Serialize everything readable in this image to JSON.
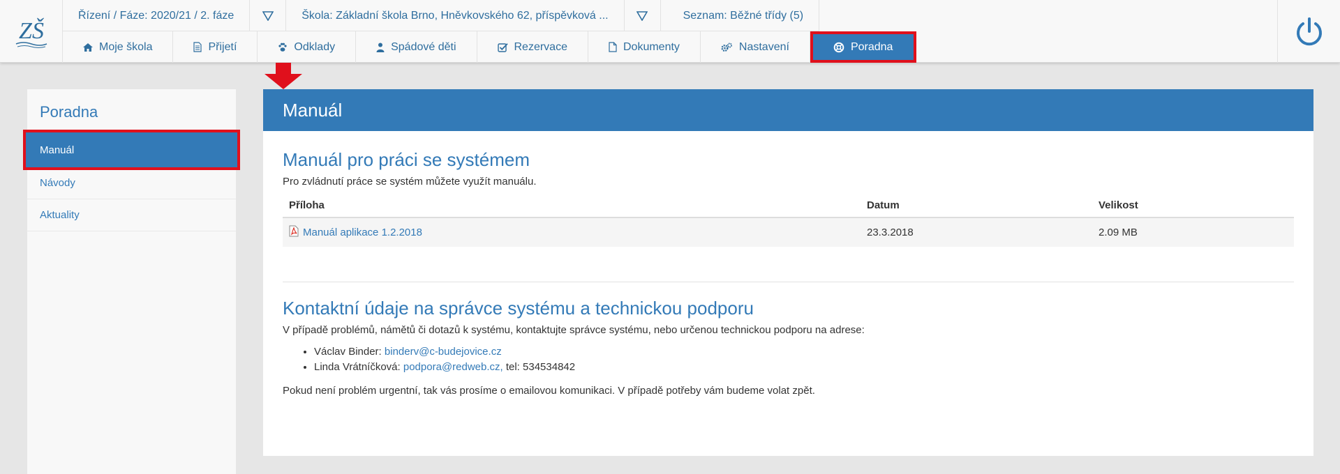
{
  "header": {
    "logo_text": "ZŠ",
    "context": {
      "phase": "Řízení / Fáze: 2020/21 / 2. fáze",
      "school": "Škola: Základní škola Brno, Hněvkovského 62, příspěvková ...",
      "list": "Seznam: Běžné třídy (5)"
    },
    "nav": [
      {
        "label": "Moje škola",
        "icon": "home-icon"
      },
      {
        "label": "Přijetí",
        "icon": "document-icon"
      },
      {
        "label": "Odklady",
        "icon": "paw-icon"
      },
      {
        "label": "Spádové děti",
        "icon": "user-icon"
      },
      {
        "label": "Rezervace",
        "icon": "checkbox-icon"
      },
      {
        "label": "Dokumenty",
        "icon": "file-icon"
      },
      {
        "label": "Nastavení",
        "icon": "gears-icon"
      },
      {
        "label": "Poradna",
        "icon": "lifebuoy-icon",
        "active": true
      }
    ]
  },
  "sidebar": {
    "title": "Poradna",
    "items": [
      {
        "label": "Manuál",
        "active": true
      },
      {
        "label": "Návody"
      },
      {
        "label": "Aktuality"
      }
    ]
  },
  "main": {
    "heading": "Manuál",
    "manual": {
      "title": "Manuál pro práci se systémem",
      "intro": "Pro zvládnutí práce se systém můžete využít manuálu.",
      "columns": [
        "Příloha",
        "Datum",
        "Velikost"
      ],
      "rows": [
        {
          "name": "Manuál aplikace 1.2.2018",
          "date": "23.3.2018",
          "size": "2.09 MB"
        }
      ]
    },
    "contact": {
      "title": "Kontaktní údaje na správce systému a technickou podporu",
      "intro": "V případě problémů, námětů či dotazů k systému, kontaktujte správce systému, nebo určenou technickou podporu na adrese:",
      "people": [
        {
          "name": "Václav Binder:",
          "email": "binderv@c-budejovice.cz",
          "extra": ""
        },
        {
          "name": "Linda Vrátníčková:",
          "email": "podpora@redweb.cz,",
          "extra": " tel: 534534842"
        }
      ],
      "note": "Pokud není problém urgentní, tak vás prosíme o emailovou komunikaci. V případě potřeby vám budeme volat zpět."
    }
  },
  "colors": {
    "accent": "#337ab7",
    "highlight": "#e0101c"
  }
}
